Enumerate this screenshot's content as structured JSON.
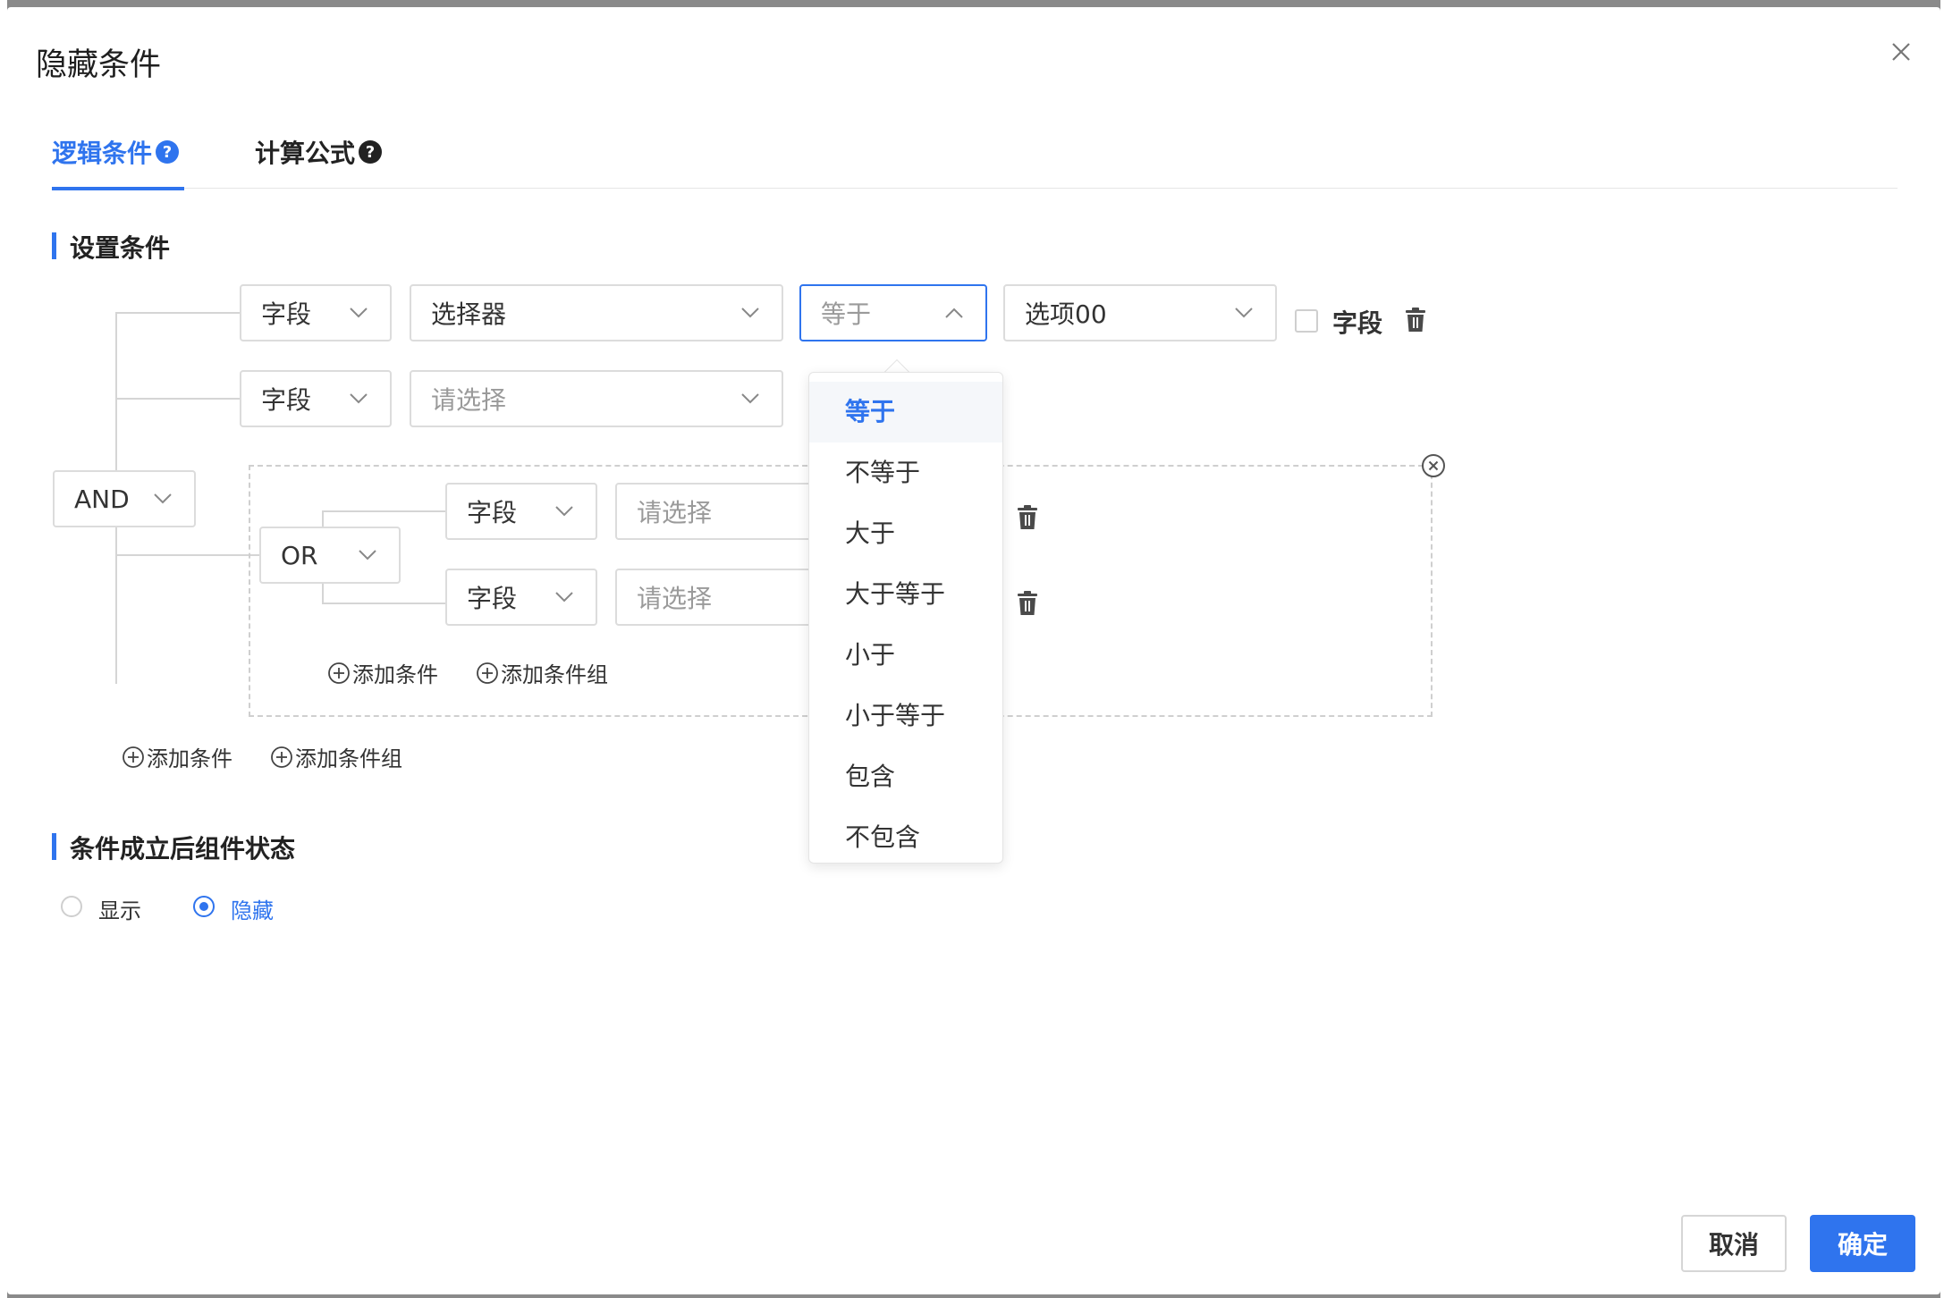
{
  "dialog": {
    "title": "隐藏条件",
    "close_icon": "close-icon"
  },
  "tabs": [
    {
      "label": "逻辑条件",
      "active": true,
      "help_icon": "help-circle-icon"
    },
    {
      "label": "计算公式",
      "active": false,
      "help_icon": "help-circle-icon"
    }
  ],
  "sections": {
    "conditions": "设置条件",
    "state": "条件成立后组件状态"
  },
  "root_logic": {
    "operator": "AND"
  },
  "conditions": [
    {
      "type": "字段",
      "field": "选择器",
      "operator_placeholder": "等于",
      "value": "选项00",
      "checkbox_label": "字段"
    },
    {
      "type": "字段",
      "field_placeholder": "请选择"
    }
  ],
  "group": {
    "operator": "OR",
    "conditions": [
      {
        "type": "字段",
        "field_placeholder": "请选择"
      },
      {
        "type": "字段",
        "field_placeholder": "请选择"
      }
    ],
    "add_condition": "添加条件",
    "add_group": "添加条件组"
  },
  "root_actions": {
    "add_condition": "添加条件",
    "add_group": "添加条件组"
  },
  "dropdown": {
    "options": [
      "等于",
      "不等于",
      "大于",
      "大于等于",
      "小于",
      "小于等于",
      "包含",
      "不包含"
    ],
    "selected": "等于"
  },
  "state": {
    "options": [
      {
        "label": "显示",
        "checked": false
      },
      {
        "label": "隐藏",
        "checked": true
      }
    ]
  },
  "footer": {
    "cancel": "取消",
    "confirm": "确定"
  },
  "colors": {
    "accent": "#2f74ee",
    "border": "#dcdcdc",
    "placeholder": "#9a9a9a"
  }
}
